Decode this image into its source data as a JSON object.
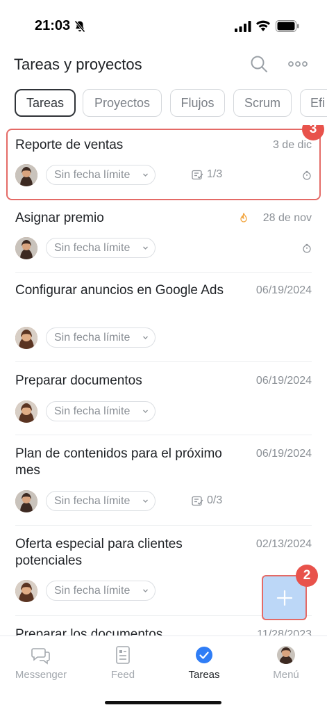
{
  "status_bar": {
    "time": "21:03"
  },
  "header": {
    "title": "Tareas y proyectos",
    "search_icon": "search-icon",
    "more_icon": "more-horizontal-icon"
  },
  "tabs": [
    {
      "label": "Tareas",
      "active": true
    },
    {
      "label": "Proyectos",
      "active": false
    },
    {
      "label": "Flujos",
      "active": false
    },
    {
      "label": "Scrum",
      "active": false
    },
    {
      "label": "Efi",
      "active": false
    }
  ],
  "tasks": [
    {
      "title": "Reporte de ventas",
      "date": "3 de dic",
      "deadline": "Sin fecha límite",
      "checklist": "1/3",
      "highlighted": true,
      "badge": "3"
    },
    {
      "title": "Asignar premio",
      "date": "28 de nov",
      "deadline": "Sin fecha límite",
      "hot": true
    },
    {
      "title": "Configurar anuncios en Google Ads",
      "date": "06/19/2024",
      "deadline": "Sin fecha límite"
    },
    {
      "title": "Preparar documentos",
      "date": "06/19/2024",
      "deadline": "Sin fecha límite"
    },
    {
      "title": "Plan de contenidos para el próximo mes",
      "date": "06/19/2024",
      "deadline": "Sin fecha límite",
      "checklist": "0/3"
    },
    {
      "title": "Oferta especial para clientes potenciales",
      "date": "02/13/2024",
      "deadline": "Sin fecha límite"
    },
    {
      "title": "Preparar los documentos",
      "date": "11/28/2023"
    }
  ],
  "fab": {
    "badge": "2",
    "icon": "plus-icon"
  },
  "tabbar": [
    {
      "label": "Messenger",
      "icon": "chat-icon",
      "active": false
    },
    {
      "label": "Feed",
      "icon": "feed-icon",
      "active": false
    },
    {
      "label": "Tareas",
      "icon": "check-circle-icon",
      "active": true
    },
    {
      "label": "Menú",
      "icon": "avatar",
      "active": false
    }
  ],
  "colors": {
    "accent": "#2f7df6",
    "highlight_border": "#e46a66",
    "badge": "#e8524b",
    "fab": "#bcd7f7",
    "hot": "#f2a33a"
  }
}
